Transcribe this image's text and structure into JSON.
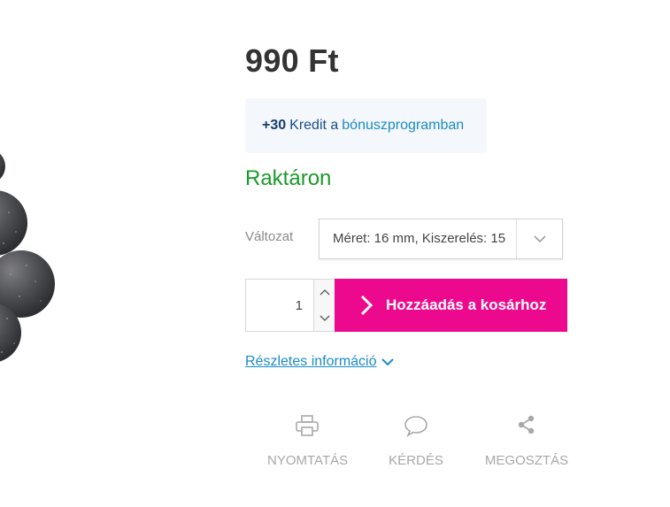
{
  "product": {
    "price": "990 Ft",
    "bonus": {
      "credit_amount": "+30",
      "credit_text": "Kredit a",
      "program_link": "bónuszprogramban"
    },
    "stock_status": "Raktáron",
    "variant": {
      "label": "Változat",
      "selected": "Méret: 16 mm, Kiszerelés: 15"
    },
    "quantity": "1",
    "add_to_cart_label": "Hozzáadás a kosárhoz",
    "details_link": "Részletes információ"
  },
  "actions": {
    "print_label": "NYOMTATÁS",
    "question_label": "KÉRDÉS",
    "share_label": "MEGOSZTÁS"
  },
  "colors": {
    "accent": "#ec098d",
    "stock_green": "#1a9a2b",
    "link_blue": "#1a8bc7",
    "bonus_bg": "#f4f7fb"
  },
  "icons": [
    "print-icon",
    "speech-bubble-icon",
    "share-icon",
    "chevron-down-icon",
    "chevron-right-icon",
    "chevron-up-icon"
  ]
}
